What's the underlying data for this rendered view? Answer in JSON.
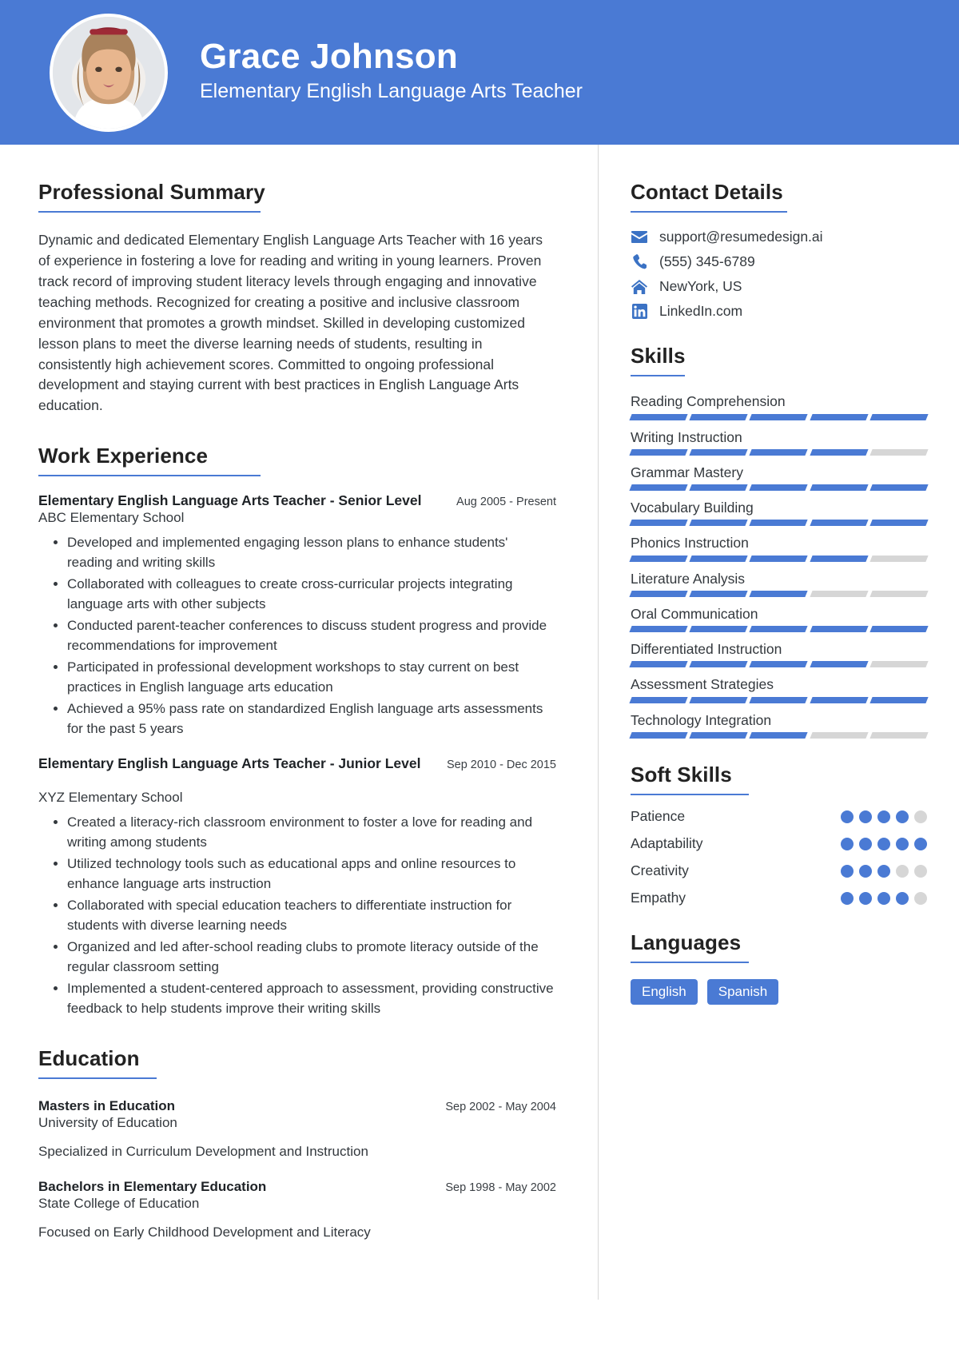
{
  "theme": {
    "accent": "#4a7ad4",
    "muted": "#d6d6d6",
    "text": "#33383d",
    "header_bg": "#4a7ad4"
  },
  "header": {
    "name": "Grace Johnson",
    "role": "Elementary English Language Arts Teacher",
    "avatar_alt": "portrait-photo"
  },
  "summary": {
    "title": "Professional Summary",
    "text": "Dynamic and dedicated Elementary English Language Arts Teacher with 16 years of experience in fostering a love for reading and writing in young learners. Proven track record of improving student literacy levels through engaging and innovative teaching methods. Recognized for creating a positive and inclusive classroom environment that promotes a growth mindset. Skilled in developing customized lesson plans to meet the diverse learning needs of students, resulting in consistently high achievement scores. Committed to ongoing professional development and staying current with best practices in English Language Arts education."
  },
  "work": {
    "title": "Work Experience",
    "jobs": [
      {
        "title": "Elementary English Language Arts Teacher - Senior Level",
        "date": "Aug 2005 - Present",
        "org": "ABC Elementary School",
        "bullets": [
          "Developed and implemented engaging lesson plans to enhance students' reading and writing skills",
          "Collaborated with colleagues to create cross-curricular projects integrating language arts with other subjects",
          "Conducted parent-teacher conferences to discuss student progress and provide recommendations for improvement",
          "Participated in professional development workshops to stay current on best practices in English language arts education",
          "Achieved a 95% pass rate on standardized English language arts assessments for the past 5 years"
        ]
      },
      {
        "title": "Elementary English Language Arts Teacher - Junior Level",
        "date": "Sep 2010 - Dec 2015",
        "org": "XYZ Elementary School",
        "bullets": [
          "Created a literacy-rich classroom environment to foster a love for reading and writing among students",
          "Utilized technology tools such as educational apps and online resources to enhance language arts instruction",
          "Collaborated with special education teachers to differentiate instruction for students with diverse learning needs",
          "Organized and led after-school reading clubs to promote literacy outside of the regular classroom setting",
          "Implemented a student-centered approach to assessment, providing constructive feedback to help students improve their writing skills"
        ]
      }
    ]
  },
  "education": {
    "title": "Education",
    "entries": [
      {
        "degree": "Masters in Education",
        "date": "Sep 2002 - May 2004",
        "school": "University of Education",
        "note": "Specialized in Curriculum Development and Instruction"
      },
      {
        "degree": "Bachelors in Elementary Education",
        "date": "Sep 1998 - May 2002",
        "school": "State College of Education",
        "note": "Focused on Early Childhood Development and Literacy"
      }
    ]
  },
  "contact": {
    "title": "Contact Details",
    "items": [
      {
        "icon": "envelope-icon",
        "value": "support@resumedesign.ai"
      },
      {
        "icon": "phone-icon",
        "value": "(555) 345-6789"
      },
      {
        "icon": "home-icon",
        "value": "NewYork, US"
      },
      {
        "icon": "linkedin-icon",
        "value": "LinkedIn.com"
      }
    ]
  },
  "skills": {
    "title": "Skills",
    "max": 5,
    "items": [
      {
        "name": "Reading Comprehension",
        "level": 5
      },
      {
        "name": "Writing Instruction",
        "level": 4
      },
      {
        "name": "Grammar Mastery",
        "level": 5
      },
      {
        "name": "Vocabulary Building",
        "level": 5
      },
      {
        "name": "Phonics Instruction",
        "level": 4
      },
      {
        "name": "Literature Analysis",
        "level": 3
      },
      {
        "name": "Oral Communication",
        "level": 5
      },
      {
        "name": "Differentiated Instruction",
        "level": 4
      },
      {
        "name": "Assessment Strategies",
        "level": 5
      },
      {
        "name": "Technology Integration",
        "level": 3
      }
    ]
  },
  "soft_skills": {
    "title": "Soft Skills",
    "max": 5,
    "items": [
      {
        "name": "Patience",
        "level": 4
      },
      {
        "name": "Adaptability",
        "level": 5
      },
      {
        "name": "Creativity",
        "level": 3
      },
      {
        "name": "Empathy",
        "level": 4
      }
    ]
  },
  "languages": {
    "title": "Languages",
    "items": [
      "English",
      "Spanish"
    ]
  }
}
